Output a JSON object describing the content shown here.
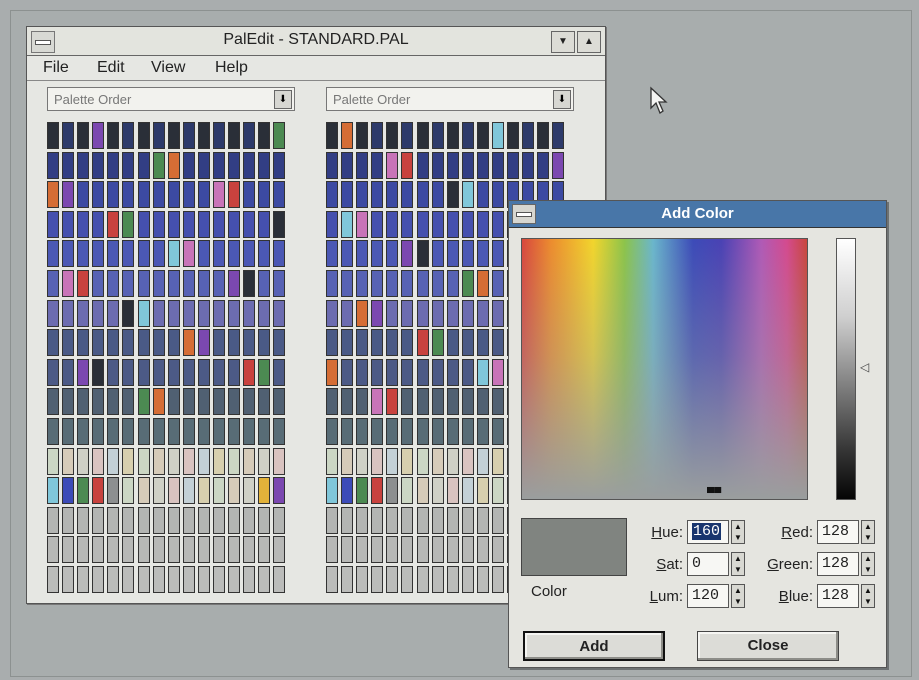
{
  "main_window": {
    "title": "PalEdit - STANDARD.PAL",
    "min_label": "▼",
    "max_label": "▲",
    "menu": [
      "File",
      "Edit",
      "View",
      "Help"
    ],
    "left_dropdown": {
      "value": "Palette Order",
      "arrow": "⬇"
    },
    "right_dropdown": {
      "value": "Palette Order",
      "arrow": "⬇"
    }
  },
  "palette_rows_colors": [
    "#2d3a6a",
    "#323e84",
    "#3c4aa2",
    "#4550ae",
    "#4b58b4",
    "#5762b4",
    "#6c6cb0",
    "#4a5a86",
    "#4c5a86",
    "#506072",
    "#586c76",
    "#cfc7bd",
    "#d5cfc6",
    "#b3b5b3",
    "#b7b8b6",
    "#bbbcba"
  ],
  "accent_colors": {
    "red": "#c8423e",
    "green": "#4c8a52",
    "orange": "#d56d35",
    "cyan": "#80c7da",
    "purple": "#7b48b0",
    "yellow": "#e2b23a",
    "pink": "#c874b8",
    "dark": "#2a2f38"
  },
  "add_color_dialog": {
    "title": "Add Color",
    "swatch_color": "#808480",
    "swatch_label": "Color",
    "hue": {
      "label_u": "H",
      "label_rest": "ue:",
      "value": "160"
    },
    "sat": {
      "label_u": "S",
      "label_rest": "at:",
      "value": "0"
    },
    "lum": {
      "label_u": "L",
      "label_rest": "um:",
      "value": "120"
    },
    "red": {
      "label_u": "R",
      "label_rest": "ed:",
      "value": "128"
    },
    "green": {
      "label_u": "G",
      "label_rest": "reen:",
      "value": "128"
    },
    "blue": {
      "label_u": "B",
      "label_rest": "lue:",
      "value": "128"
    },
    "add_button": "Add",
    "close_button": "Close",
    "lum_arrow": "◁",
    "spectrum_marker": "▄▄"
  }
}
